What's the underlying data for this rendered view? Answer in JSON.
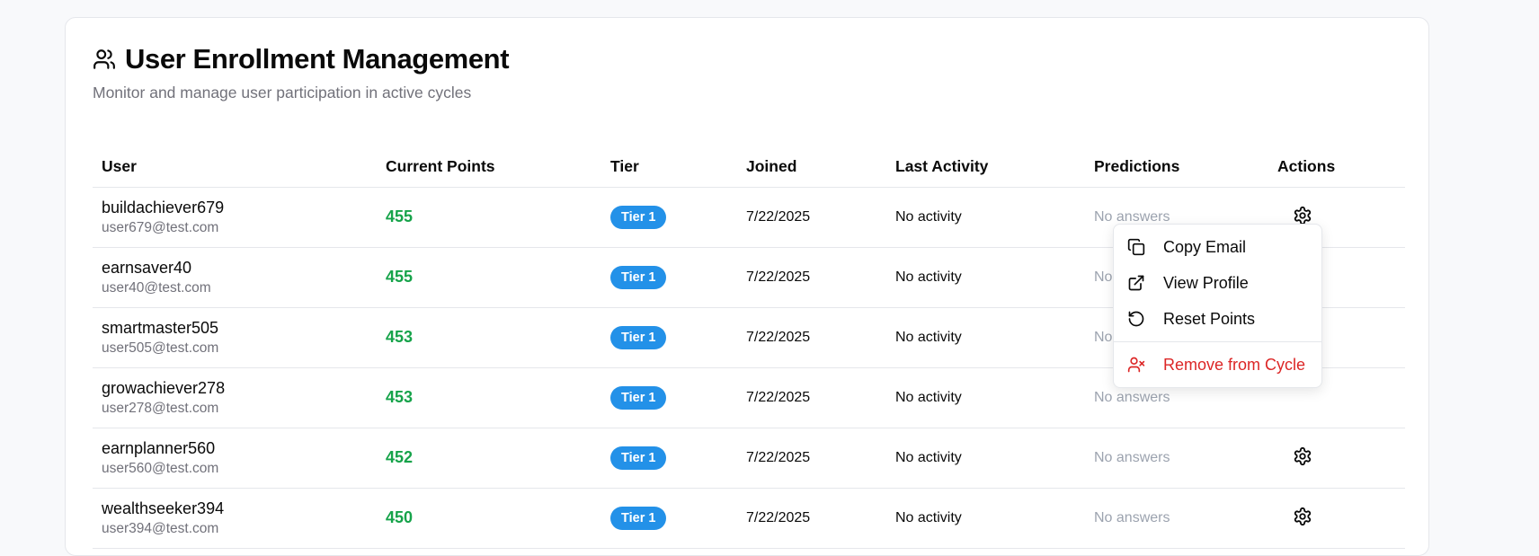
{
  "header": {
    "title": "User Enrollment Management",
    "subtitle": "Monitor and manage user participation in active cycles",
    "icon": "users-icon"
  },
  "table": {
    "columns": [
      "User",
      "Current Points",
      "Tier",
      "Joined",
      "Last Activity",
      "Predictions",
      "Actions"
    ],
    "rows": [
      {
        "username": "buildachiever679",
        "email": "user679@test.com",
        "points": "455",
        "tier": "Tier 1",
        "joined": "7/22/2025",
        "last_activity": "No activity",
        "predictions": "No answers"
      },
      {
        "username": "earnsaver40",
        "email": "user40@test.com",
        "points": "455",
        "tier": "Tier 1",
        "joined": "7/22/2025",
        "last_activity": "No activity",
        "predictions": "No answers"
      },
      {
        "username": "smartmaster505",
        "email": "user505@test.com",
        "points": "453",
        "tier": "Tier 1",
        "joined": "7/22/2025",
        "last_activity": "No activity",
        "predictions": "No answers"
      },
      {
        "username": "growachiever278",
        "email": "user278@test.com",
        "points": "453",
        "tier": "Tier 1",
        "joined": "7/22/2025",
        "last_activity": "No activity",
        "predictions": "No answers"
      },
      {
        "username": "earnplanner560",
        "email": "user560@test.com",
        "points": "452",
        "tier": "Tier 1",
        "joined": "7/22/2025",
        "last_activity": "No activity",
        "predictions": "No answers"
      },
      {
        "username": "wealthseeker394",
        "email": "user394@test.com",
        "points": "450",
        "tier": "Tier 1",
        "joined": "7/22/2025",
        "last_activity": "No activity",
        "predictions": "No answers"
      }
    ]
  },
  "menu": {
    "items": [
      {
        "label": "Copy Email",
        "icon": "copy-icon"
      },
      {
        "label": "View Profile",
        "icon": "external-link-icon"
      },
      {
        "label": "Reset Points",
        "icon": "rotate-ccw-icon"
      },
      {
        "label": "Remove from Cycle",
        "icon": "user-x-icon"
      }
    ]
  },
  "colors": {
    "points": "#16a34a",
    "tier_badge": "#2391e8",
    "danger": "#dc2626",
    "muted": "#71717a"
  }
}
